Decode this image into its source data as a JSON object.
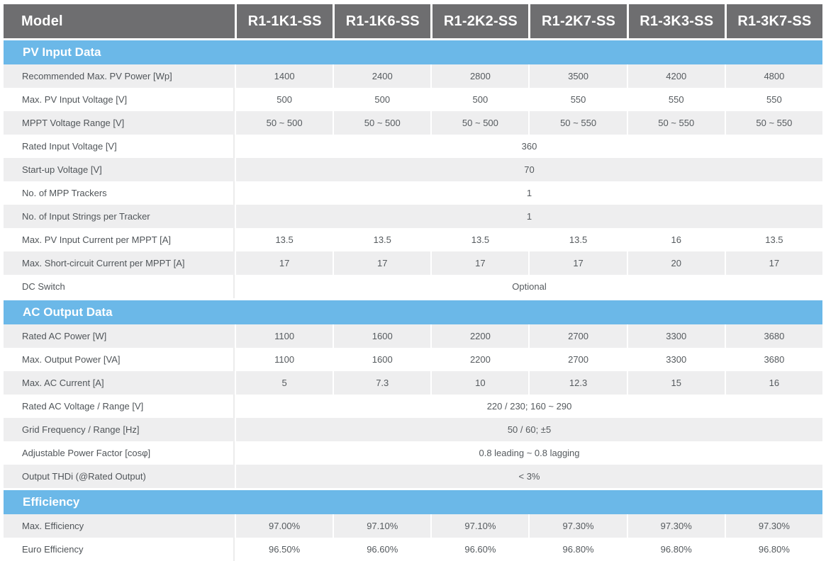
{
  "header": {
    "label": "Model",
    "models": [
      "R1-1K1-SS",
      "R1-1K6-SS",
      "R1-2K2-SS",
      "R1-2K7-SS",
      "R1-3K3-SS",
      "R1-3K7-SS"
    ]
  },
  "sections": [
    {
      "title": "PV Input Data",
      "rows": [
        {
          "label": "Recommended Max. PV Power [Wp]",
          "values": [
            "1400",
            "2400",
            "2800",
            "3500",
            "4200",
            "4800"
          ]
        },
        {
          "label": "Max. PV Input Voltage [V]",
          "values": [
            "500",
            "500",
            "500",
            "550",
            "550",
            "550"
          ]
        },
        {
          "label": "MPPT Voltage Range [V]",
          "values": [
            "50 ~ 500",
            "50 ~ 500",
            "50 ~ 500",
            "50 ~ 550",
            "50 ~ 550",
            "50 ~ 550"
          ]
        },
        {
          "label": "Rated Input Voltage [V]",
          "values": [
            "360"
          ]
        },
        {
          "label": "Start-up Voltage [V]",
          "values": [
            "70"
          ]
        },
        {
          "label": "No. of MPP Trackers",
          "values": [
            "1"
          ]
        },
        {
          "label": "No. of Input Strings per Tracker",
          "values": [
            "1"
          ]
        },
        {
          "label": "Max. PV Input Current per MPPT [A]",
          "values": [
            "13.5",
            "13.5",
            "13.5",
            "13.5",
            "16",
            "13.5"
          ]
        },
        {
          "label": "Max. Short-circuit Current per MPPT [A]",
          "values": [
            "17",
            "17",
            "17",
            "17",
            "20",
            "17"
          ]
        },
        {
          "label": "DC Switch",
          "values": [
            "Optional"
          ]
        }
      ]
    },
    {
      "title": "AC Output Data",
      "rows": [
        {
          "label": "Rated AC Power [W]",
          "values": [
            "1100",
            "1600",
            "2200",
            "2700",
            "3300",
            "3680"
          ]
        },
        {
          "label": "Max. Output Power [VA]",
          "values": [
            "1100",
            "1600",
            "2200",
            "2700",
            "3300",
            "3680"
          ]
        },
        {
          "label": "Max. AC Current [A]",
          "values": [
            "5",
            "7.3",
            "10",
            "12.3",
            "15",
            "16"
          ]
        },
        {
          "label": "Rated AC Voltage / Range [V]",
          "values": [
            "220 / 230; 160 ~ 290"
          ]
        },
        {
          "label": "Grid Frequency / Range [Hz]",
          "values": [
            "50 / 60; ±5"
          ]
        },
        {
          "label": "Adjustable Power Factor [cosφ]",
          "values": [
            "0.8 leading ~ 0.8 lagging"
          ]
        },
        {
          "label": "Output THDi (@Rated Output)",
          "values": [
            "< 3%"
          ]
        }
      ]
    },
    {
      "title": "Efficiency",
      "rows": [
        {
          "label": "Max. Efficiency",
          "values": [
            "97.00%",
            "97.10%",
            "97.10%",
            "97.30%",
            "97.30%",
            "97.30%"
          ]
        },
        {
          "label": "Euro Efficiency",
          "values": [
            "96.50%",
            "96.60%",
            "96.60%",
            "96.80%",
            "96.80%",
            "96.80%"
          ]
        }
      ]
    }
  ]
}
